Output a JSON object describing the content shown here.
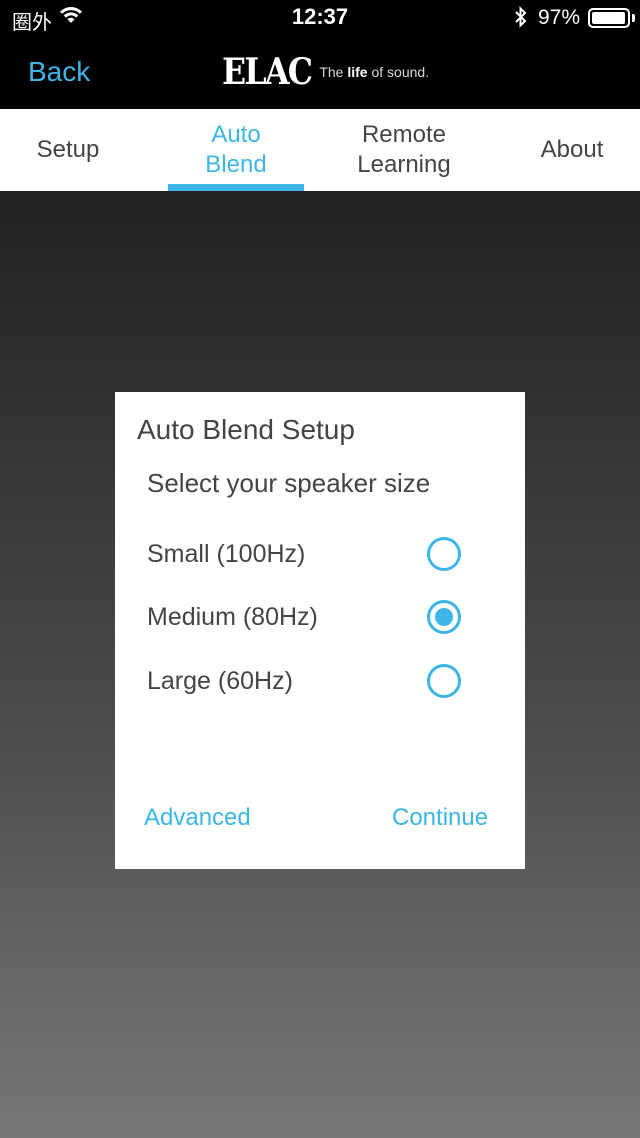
{
  "status_bar": {
    "carrier": "圈外",
    "time": "12:37",
    "battery_percent": "97%",
    "battery_level": 0.97,
    "icons": [
      "wifi-icon",
      "bluetooth-icon",
      "battery-icon"
    ]
  },
  "nav": {
    "back_label": "Back",
    "logo": {
      "mark": "ELAC",
      "tagline_the": "The ",
      "tagline_life": "life",
      "tagline_rest": " of sound."
    }
  },
  "tabs": [
    {
      "label": "Setup",
      "active": false
    },
    {
      "label": "Auto Blend",
      "active": true
    },
    {
      "label": "Remote Learning",
      "active": false
    },
    {
      "label": "About",
      "active": false
    }
  ],
  "dialog": {
    "title": "Auto Blend Setup",
    "subtitle": "Select your speaker size",
    "options": [
      {
        "label": "Small (100Hz)",
        "selected": false
      },
      {
        "label": "Medium (80Hz)",
        "selected": true
      },
      {
        "label": "Large (60Hz)",
        "selected": false
      }
    ],
    "advanced_label": "Advanced",
    "continue_label": "Continue"
  },
  "colors": {
    "accent": "#3db5e6",
    "text": "#444444",
    "bar_background": "#000000"
  }
}
